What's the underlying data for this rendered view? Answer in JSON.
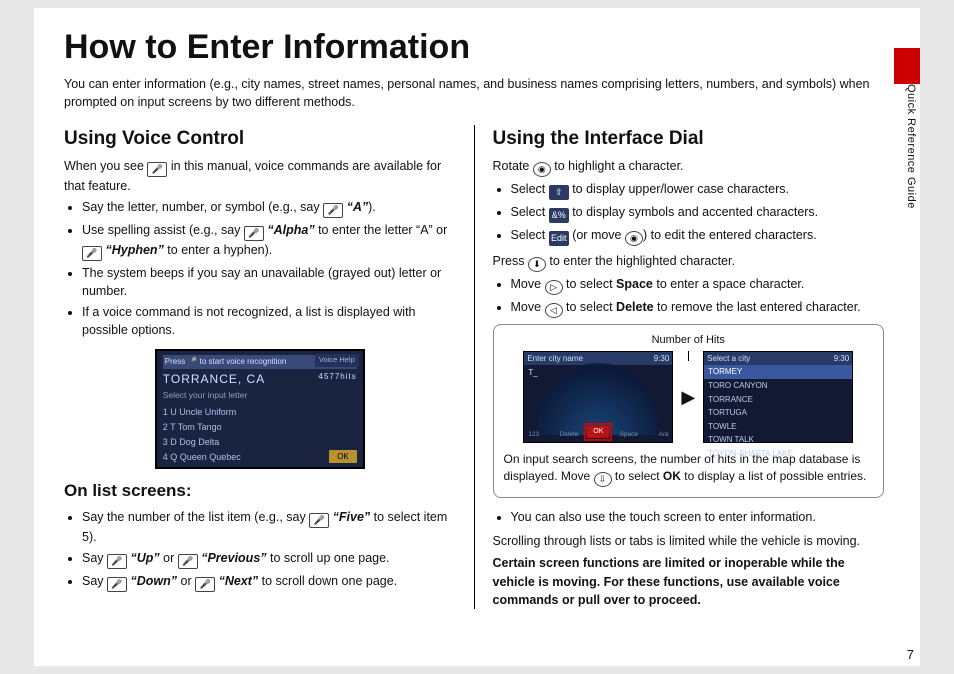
{
  "sideTab": "Quick Reference Guide",
  "title": "How to Enter Information",
  "intro": "You can enter information (e.g., city names, street names, personal names, and business names comprising letters, numbers, and symbols) when prompted on input screens by two different methods.",
  "left": {
    "h1": "Using Voice Control",
    "lead1a": "When you see ",
    "lead1b": " in this manual, voice commands are available for that feature.",
    "b1a": "Say the letter, number, or symbol (e.g., say ",
    "b1em": "“A”",
    "b1b": ").",
    "b2a": "Use spelling assist (e.g., say ",
    "b2em1": "“Alpha”",
    "b2b": " to enter the letter “A” or ",
    "b2em2": "“Hyphen”",
    "b2c": " to enter a hyphen).",
    "b3": "The system beeps if you say an unavailable (grayed out) letter or number.",
    "b4": "If a voice command is not recognized, a list is displayed with possible options.",
    "shot": {
      "bar": "Press 🎤 to start voice recognition",
      "vh": "Voice Help",
      "title": "TORRANCE, CA",
      "hits": "4577hits",
      "sub": "Select your input letter",
      "rows": [
        "1  U Uncle Uniform",
        "2  T Tom Tango",
        "3  D Dog Delta",
        "4  Q Queen Quebec"
      ],
      "ok": "OK"
    },
    "h2": "On list screens:",
    "l1a": "Say the number of the list item (e.g., say ",
    "l1em": "“Five”",
    "l1b": " to select item 5).",
    "l2a": "Say ",
    "l2em1": "“Up”",
    "l2b": " or ",
    "l2em2": "“Previous”",
    "l2c": " to scroll up one page.",
    "l3a": "Say ",
    "l3em1": "“Down”",
    "l3b": " or ",
    "l3em2": "“Next”",
    "l3c": " to scroll down one page."
  },
  "right": {
    "h1": "Using the Interface Dial",
    "r1a": "Rotate ",
    "r1b": " to highlight a character.",
    "b1a": "Select ",
    "b1b": " to display upper/lower case characters.",
    "b2a": "Select ",
    "b2b": " to display symbols and accented characters.",
    "b3a": "Select ",
    "b3b": " (or move ",
    "b3c": ") to edit the entered characters.",
    "r2a": "Press ",
    "r2b": " to enter the highlighted character.",
    "b4a": "Move ",
    "b4b": " to select ",
    "b4s": "Space",
    "b4c": " to enter a space character.",
    "b5a": "Move ",
    "b5b": " to select ",
    "b5s": "Delete",
    "b5c": " to remove the last entered character.",
    "numhits": "Number of Hits",
    "ok": "OK",
    "shotA": {
      "hd": "Enter city name",
      "time": "9:30",
      "ft1": "123",
      "ft2": "Delete",
      "ft3": "OK",
      "ft4": "Space",
      "ft5": "A/a",
      "letter": "T_"
    },
    "shotB": {
      "hd": "Select a city",
      "time": "9:30",
      "items": [
        "TORMEY",
        "TORO CANYON",
        "TORRANCE",
        "TORTUGA",
        "TOWLE",
        "TOWN TALK",
        "TOYON-SHASTA LAKE"
      ]
    },
    "capA": "On input search screens, the number of hits in the map database is displayed. Move ",
    "capB": " to select ",
    "capOK": "OK",
    "capC": " to display a list of possible entries.",
    "touch": "You can also use the touch screen to enter information.",
    "scroll": "Scrolling through lists or tabs is limited while the vehicle is moving.",
    "warn": "Certain screen functions are limited or inoperable while the vehicle is moving. For these functions, use available voice commands or pull over to proceed."
  },
  "icons": {
    "voice": "🎤",
    "shift": "⇧",
    "sym": "&%",
    "edit": "Edit",
    "dial": "◉",
    "press": "⬇",
    "right": "▷",
    "left": "◁",
    "down": "⇩"
  },
  "pageNum": "7"
}
